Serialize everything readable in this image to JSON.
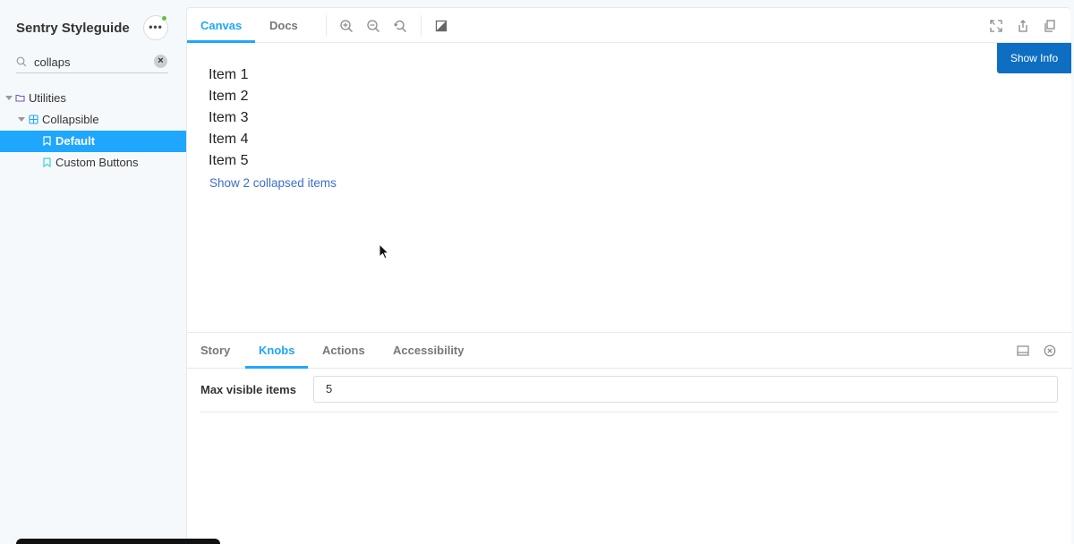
{
  "sidebar": {
    "brand": "Sentry Styleguide",
    "search": {
      "value": "collaps"
    },
    "tree": [
      {
        "label": "Utilities",
        "kind": "folder",
        "expanded": true,
        "selected": false
      },
      {
        "label": "Collapsible",
        "kind": "component",
        "expanded": true,
        "selected": false
      },
      {
        "label": "Default",
        "kind": "story",
        "selected": true
      },
      {
        "label": "Custom Buttons",
        "kind": "story",
        "selected": false
      }
    ]
  },
  "toolbar": {
    "tabs": [
      {
        "label": "Canvas",
        "active": true
      },
      {
        "label": "Docs",
        "active": false
      }
    ],
    "icons": [
      "zoom-in-icon",
      "zoom-out-icon",
      "zoom-reset-icon",
      "background-icon",
      "fullscreen-icon",
      "share-icon",
      "copy-icon"
    ]
  },
  "canvas": {
    "show_info_label": "Show Info",
    "items": [
      "Item 1",
      "Item 2",
      "Item 3",
      "Item 4",
      "Item 5"
    ],
    "expand_link": "Show 2 collapsed items"
  },
  "addons": {
    "tabs": [
      {
        "label": "Story",
        "active": false
      },
      {
        "label": "Knobs",
        "active": true
      },
      {
        "label": "Actions",
        "active": false
      },
      {
        "label": "Accessibility",
        "active": false
      }
    ],
    "knob": {
      "label": "Max visible items",
      "value": "5"
    }
  },
  "colors": {
    "accent": "#1ea7fd",
    "show_info_bg": "#0d6ec2",
    "link": "#3b6ecc",
    "status_online": "#66bf3c"
  }
}
